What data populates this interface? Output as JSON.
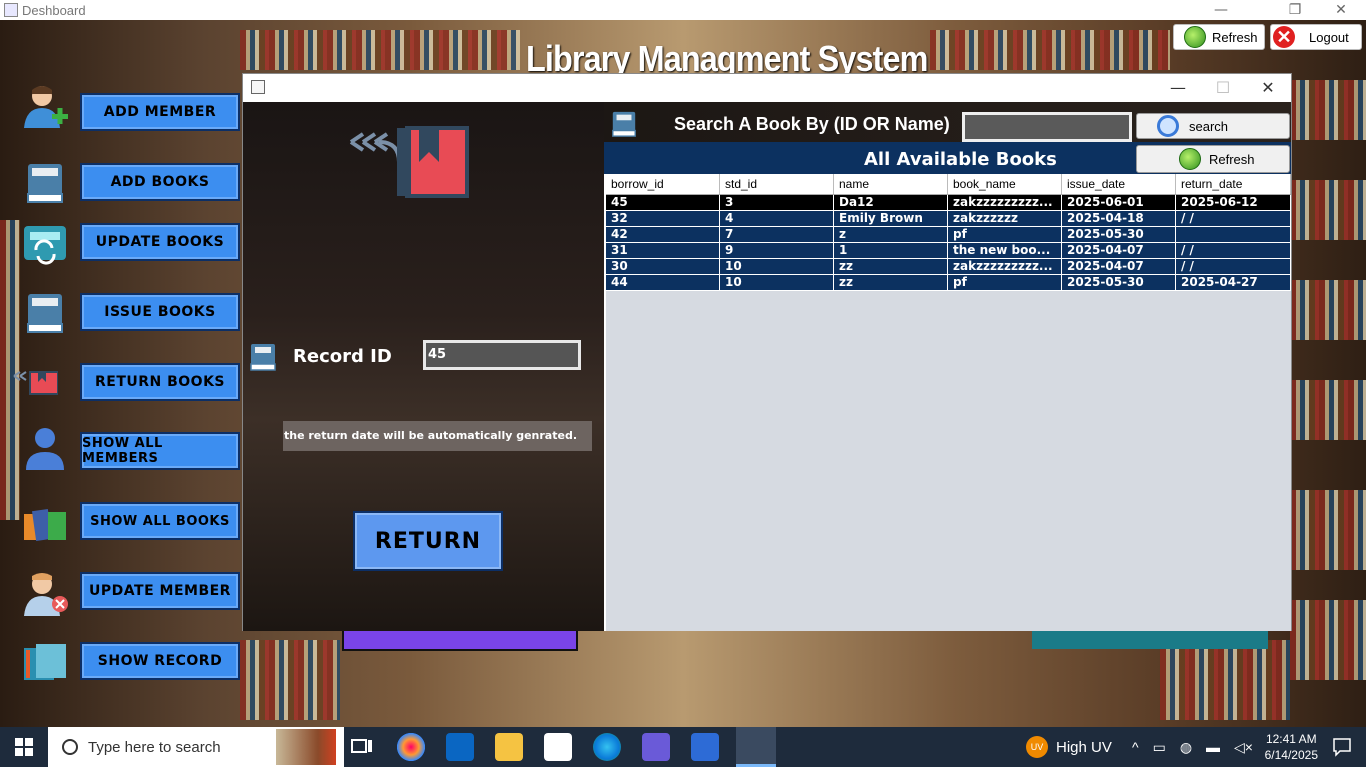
{
  "window": {
    "title": "Deshboard",
    "minimize": "—",
    "maximize": "❐",
    "close": "✕"
  },
  "header": {
    "app_title": "Library Managment System",
    "refresh_label": "Refresh",
    "logout_label": "Logout"
  },
  "sidebar": {
    "items": [
      {
        "label": "ADD MEMBER",
        "icon": "add-member-icon"
      },
      {
        "label": "ADD BOOKS",
        "icon": "book-icon"
      },
      {
        "label": "UPDATE BOOKS",
        "icon": "update-books-icon"
      },
      {
        "label": "ISSUE BOOKS",
        "icon": "book-icon"
      },
      {
        "label": "RETURN BOOKS",
        "icon": "return-book-icon"
      },
      {
        "label": "SHOW ALL MEMBERS",
        "icon": "user-icon"
      },
      {
        "label": "SHOW ALL BOOKS",
        "icon": "books-stack-icon"
      },
      {
        "label": "UPDATE MEMBER",
        "icon": "update-member-icon"
      },
      {
        "label": "SHOW RECORD",
        "icon": "record-icon"
      }
    ]
  },
  "dialog": {
    "minimize": "—",
    "maximize": "☐",
    "close": "✕",
    "left": {
      "record_label": "Record ID",
      "record_value": "45",
      "note": "the return date will be automatically genrated.",
      "return_label": "RETURN"
    },
    "right": {
      "search_label": "Search A Book By (ID OR Name)",
      "search_value": "",
      "search_button": "search",
      "refresh_button": "Refresh",
      "table_title": "All Available Books",
      "columns": [
        "borrow_id",
        "std_id",
        "name",
        "book_name",
        "issue_date",
        "return_date"
      ],
      "rows": [
        [
          "45",
          "3",
          "Da12",
          "zakzzzzzzzzz...",
          "2025-06-01",
          "2025-06-12"
        ],
        [
          "32",
          "4",
          "Emily Brown",
          "zakzzzzzz",
          "2025-04-18",
          "/  /"
        ],
        [
          "42",
          "7",
          "z",
          "pf",
          "2025-05-30",
          ""
        ],
        [
          "31",
          "9",
          "1",
          "the new boo...",
          "2025-04-07",
          "/  /"
        ],
        [
          "30",
          "10",
          "zz",
          "zakzzzzzzzzz...",
          "2025-04-07",
          "/  /"
        ],
        [
          "44",
          "10",
          "zz",
          "pf",
          "2025-05-30",
          "2025-04-27"
        ]
      ]
    }
  },
  "taskbar": {
    "search_placeholder": "Type here to search",
    "weather_label": "High UV",
    "weather_badge": "UV",
    "time": "12:41 AM",
    "date": "6/14/2025"
  }
}
